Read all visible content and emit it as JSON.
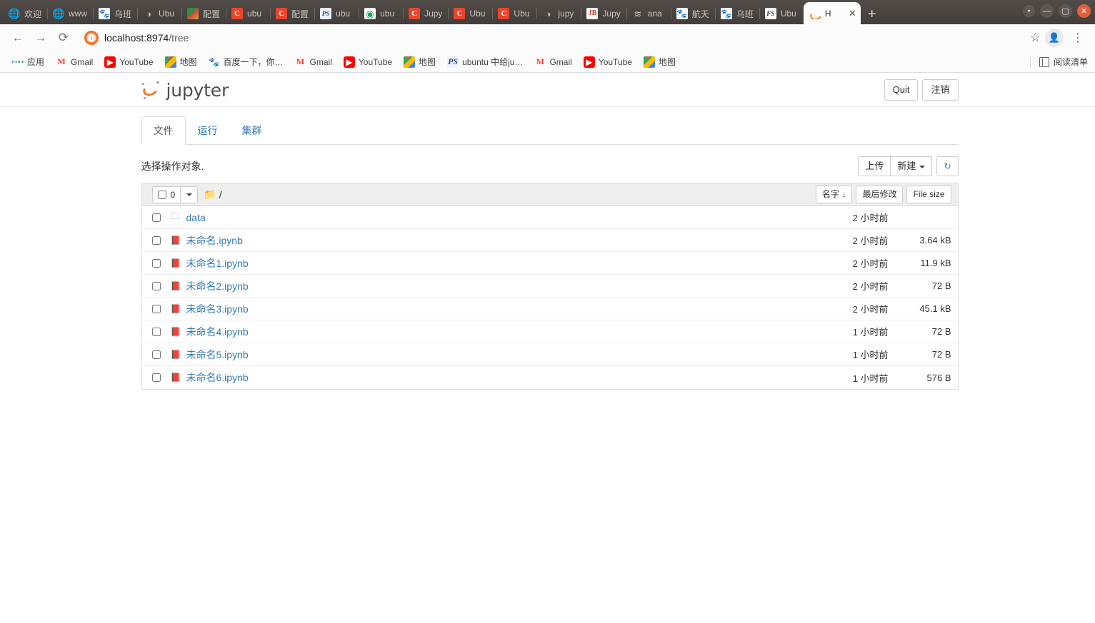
{
  "browser": {
    "tabs": [
      {
        "icon": "globe-icon",
        "label": "欢迎",
        "active": false
      },
      {
        "icon": "globe-icon",
        "label": "www",
        "active": false
      },
      {
        "icon": "baidu-icon",
        "label": "乌班",
        "active": false
      },
      {
        "icon": "ubuntu-icon",
        "label": "Ubu",
        "active": false
      },
      {
        "icon": "picture-icon",
        "label": "配置",
        "active": false
      },
      {
        "icon": "csdn-icon",
        "label": "ubu",
        "active": false
      },
      {
        "icon": "csdn-icon",
        "label": "配置",
        "active": false
      },
      {
        "icon": "ps-icon",
        "label": "ubu",
        "active": false
      },
      {
        "icon": "nvidia-icon",
        "label": "ubu",
        "active": false
      },
      {
        "icon": "csdn-icon",
        "label": "Jupy",
        "active": false
      },
      {
        "icon": "csdn-icon",
        "label": "Ubu",
        "active": false
      },
      {
        "icon": "csdn-icon",
        "label": "Ubu",
        "active": false
      },
      {
        "icon": "jupyter-gray-icon",
        "label": "jupy",
        "active": false
      },
      {
        "icon": "jetbrains-icon",
        "label": "Jupy",
        "active": false
      },
      {
        "icon": "anaconda-icon",
        "label": "ana",
        "active": false
      },
      {
        "icon": "baidu-icon",
        "label": "航天",
        "active": false
      },
      {
        "icon": "baidu-icon",
        "label": "乌班",
        "active": false
      },
      {
        "icon": "fs-icon",
        "label": "Ubu",
        "active": false
      },
      {
        "icon": "jupyter-logo-icon",
        "label": "H",
        "active": true
      }
    ],
    "new_tab_label": "+",
    "window_controls": {
      "dropdown": "▾",
      "minimize": "—",
      "maximize": "▢",
      "close": "✕"
    },
    "nav": {
      "back": "←",
      "forward": "→",
      "reload": "⟳",
      "info_icon": "ⓘ",
      "url_host": "localhost:8974",
      "url_path": "/tree",
      "star": "☆",
      "profile": "👤",
      "menu": "⋮"
    },
    "bookmarks": [
      {
        "icon": "apps-grid-icon",
        "label": "应用"
      },
      {
        "icon": "gmail-icon",
        "label": "Gmail"
      },
      {
        "icon": "youtube-icon",
        "label": "YouTube"
      },
      {
        "icon": "maps-icon",
        "label": "地图"
      },
      {
        "icon": "baidu-icon",
        "label": "百度一下，你…"
      },
      {
        "icon": "gmail-icon",
        "label": "Gmail"
      },
      {
        "icon": "youtube-icon",
        "label": "YouTube"
      },
      {
        "icon": "maps-icon",
        "label": "地图"
      },
      {
        "icon": "ps-icon",
        "label": "ubuntu 中给ju…"
      },
      {
        "icon": "gmail-icon",
        "label": "Gmail"
      },
      {
        "icon": "youtube-icon",
        "label": "YouTube"
      },
      {
        "icon": "maps-icon",
        "label": "地图"
      }
    ],
    "reading_list": "阅读清单"
  },
  "jupyter": {
    "logo_text": "jupyter",
    "quit_label": "Quit",
    "logout_label": "注销",
    "tabs": [
      {
        "label": "文件",
        "active": true
      },
      {
        "label": "运行",
        "active": false
      },
      {
        "label": "集群",
        "active": false
      }
    ],
    "hint": "选择操作对象.",
    "upload_label": "上传",
    "new_label": "新建",
    "refresh_icon": "↻",
    "select_count": "0",
    "breadcrumb": "/",
    "sort": {
      "name_label": "名字",
      "name_arrow": "↓",
      "modified_label": "最后修改",
      "size_label": "File size"
    },
    "files": [
      {
        "type": "folder",
        "icon": "folder-icon",
        "name": "data",
        "modified": "2 小时前",
        "size": ""
      },
      {
        "type": "notebook",
        "icon": "notebook-icon",
        "name": "未命名.ipynb",
        "modified": "2 小时前",
        "size": "3.64 kB"
      },
      {
        "type": "notebook",
        "icon": "notebook-icon",
        "name": "未命名1.ipynb",
        "modified": "2 小时前",
        "size": "11.9 kB"
      },
      {
        "type": "notebook",
        "icon": "notebook-icon",
        "name": "未命名2.ipynb",
        "modified": "2 小时前",
        "size": "72 B"
      },
      {
        "type": "notebook",
        "icon": "notebook-icon",
        "name": "未命名3.ipynb",
        "modified": "2 小时前",
        "size": "45.1 kB"
      },
      {
        "type": "notebook",
        "icon": "notebook-icon",
        "name": "未命名4.ipynb",
        "modified": "1 小时前",
        "size": "72 B"
      },
      {
        "type": "notebook",
        "icon": "notebook-icon",
        "name": "未命名5.ipynb",
        "modified": "1 小时前",
        "size": "72 B"
      },
      {
        "type": "notebook",
        "icon": "notebook-icon",
        "name": "未命名6.ipynb",
        "modified": "1 小时前",
        "size": "576 B"
      }
    ]
  },
  "colors": {
    "jupyter_orange": "#f37726",
    "link_blue": "#337ab7",
    "chrome_bar": "#4a4542",
    "close_orange": "#e2603c"
  }
}
